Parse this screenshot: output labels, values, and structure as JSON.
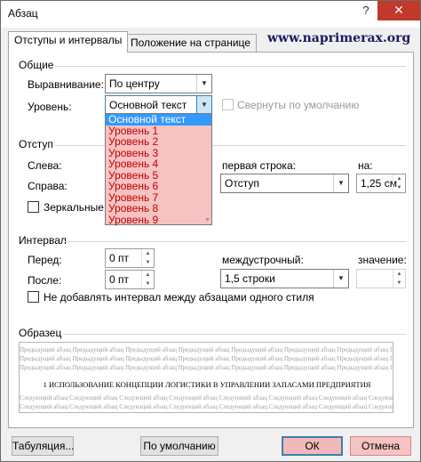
{
  "window": {
    "title": "Абзац",
    "help": "?",
    "close": "✕"
  },
  "tabs": [
    {
      "label": "Отступы и интервалы"
    },
    {
      "label": "Положение на странице"
    }
  ],
  "watermark": "www.naprimerax.org",
  "general": {
    "title": "Общие",
    "alignment_label": "Выравнивание:",
    "alignment_value": "По центру",
    "level_label": "Уровень:",
    "level_value": "Основной текст",
    "collapsed_label": "Свернуты по умолчанию",
    "level_options": [
      "Основной текст",
      "Уровень 1",
      "Уровень 2",
      "Уровень 3",
      "Уровень 4",
      "Уровень 5",
      "Уровень 6",
      "Уровень 7",
      "Уровень 8",
      "Уровень 9"
    ]
  },
  "indent": {
    "title": "Отступ",
    "left_label": "Слева:",
    "right_label": "Справа:",
    "mirror_label": "Зеркальные от",
    "first_line_label": "первая строка:",
    "first_line_value": "Отступ",
    "by_label": "на:",
    "by_value": "1,25 см"
  },
  "spacing": {
    "title": "Интервал",
    "before_label": "Перед:",
    "before_value": "0 пт",
    "after_label": "После:",
    "after_value": "0 пт",
    "line_label": "междустрочный:",
    "line_value": "1,5 строки",
    "value_label": "значение:",
    "no_space_label": "Не добавлять интервал между абзацами одного стиля"
  },
  "preview": {
    "title": "Образец",
    "prev_text": "Предыдущий абзац",
    "next_text": "Следующий абзац",
    "main_text": "1 ИСПОЛЬЗОВАНИЕ КОНЦЕПЦИИ ЛОГИСТИКИ В УПРАВЛЕНИИ ЗАПАСАМИ ПРЕДПРИЯТИЯ"
  },
  "buttons": {
    "tabs": "Табуляция...",
    "default": "По умолчанию",
    "ok": "ОК",
    "cancel": "Отмена"
  },
  "colors": {
    "highlight": "#f7c2c2",
    "selection": "#3399ff",
    "dropdown_text": "#c00000"
  }
}
